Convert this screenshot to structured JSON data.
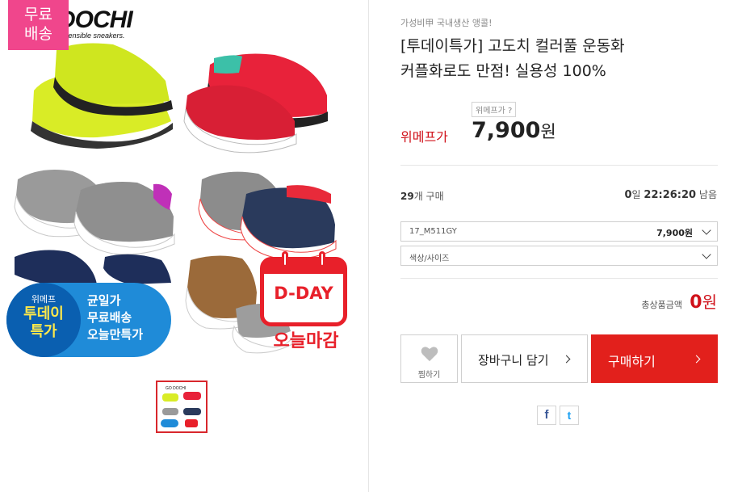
{
  "left": {
    "free_shipping_badge": "무료\n배송",
    "brand": "DOCHI",
    "brand_tagline": "sensible sneakers.",
    "promo": {
      "brand_small": "위메프",
      "brand_big": "투데이\n특가",
      "lines": [
        "균일가",
        "무료배송",
        "오늘만특가"
      ]
    },
    "dday": "D-DAY",
    "dday_caption": "오늘마감"
  },
  "product": {
    "subtitle": "가성비甲 국내생산 앵콜!",
    "title": "[투데이특가] 고도치 컬러풀 운동화\n커플화로도 만점! 실용성 100%",
    "wemap_tag": "위메프가 ?",
    "price_label": "위메프가",
    "price": "7,900",
    "price_unit": "원",
    "purchase_count": "29",
    "purchase_suffix": "개 구매",
    "countdown_days": "0",
    "countdown_day_unit": "일",
    "countdown_time": "22:26:20",
    "countdown_suffix": "남음"
  },
  "options": [
    {
      "label": "17_M511GY",
      "value": "7,900원"
    },
    {
      "label": "색상/사이즈",
      "value": ""
    }
  ],
  "total": {
    "label": "총상품금액",
    "value": "0",
    "unit": "원"
  },
  "buttons": {
    "wish": "찜하기",
    "cart": "장바구니 담기",
    "buy": "구매하기"
  },
  "share": {
    "facebook": "f",
    "twitter": "t"
  },
  "colors": {
    "accent_red": "#e2201c",
    "price_red": "#d0111a",
    "badge_pink": "#f0468c",
    "promo_blue": "#1f8bd8"
  }
}
